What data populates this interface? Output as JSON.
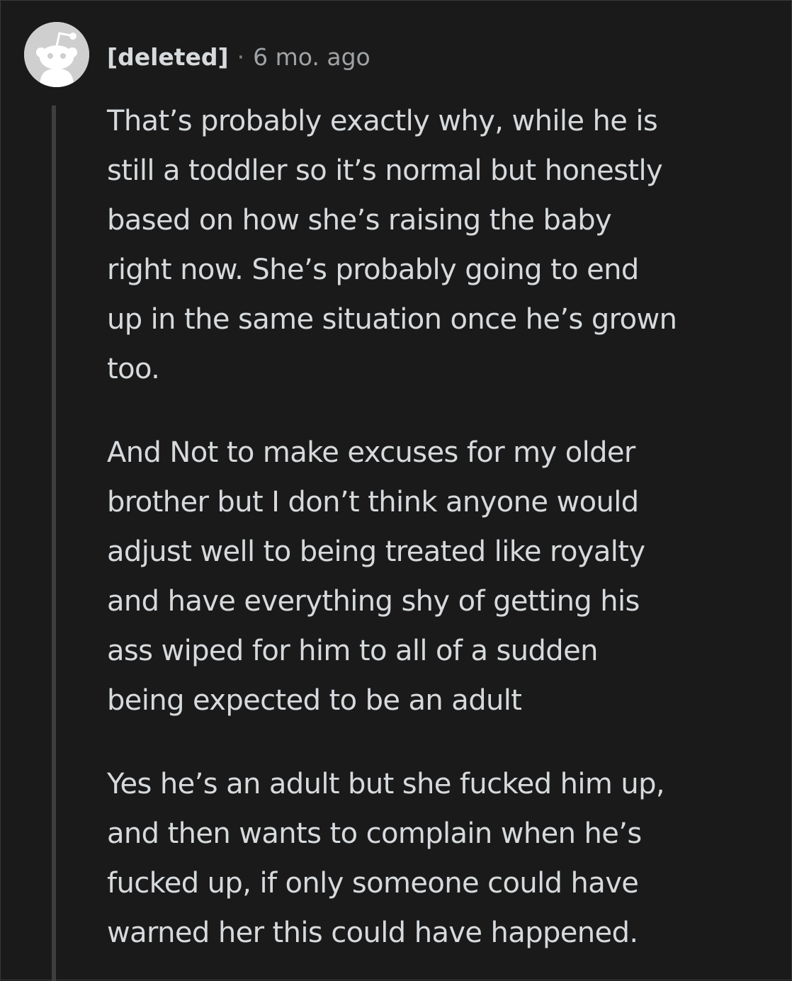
{
  "comment": {
    "author": "[deleted]",
    "separator": "·",
    "timestamp": "6 mo. ago",
    "avatar_icon": "reddit-snoo-icon",
    "paragraphs": [
      "That’s probably exactly why, while he is\nstill a toddler so it’s normal but honestly\nbased on how she’s raising the baby\nright now. She’s probably going to end\nup in the same situation once he’s grown\ntoo.",
      "And Not to make excuses for my older\nbrother but I don’t think anyone would\nadjust well to being treated like royalty\nand have everything shy of getting his\nass wiped for him to all of a sudden\nbeing expected to be an adult",
      "Yes he’s an adult but she fucked him up,\nand then wants to complain when he’s\nfucked up, if only someone could have\nwarned her this could have happened."
    ]
  },
  "colors": {
    "background": "#1a1a1b",
    "text": "#d7dadc",
    "meta_text": "#a0a3a5",
    "thread_line": "#3d3e40",
    "avatar_bg": "#cfcfcf"
  }
}
